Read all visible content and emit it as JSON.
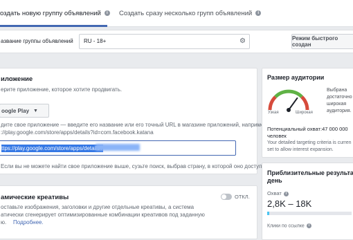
{
  "tabs": [
    {
      "label": "оздать новую группу объявлений"
    },
    {
      "label": "Создать сразу несколько групп объявлений"
    }
  ],
  "adset_name": {
    "label": "азвание группы объявлений",
    "value": "RU - 18+",
    "quick_mode_button": "Режим быстрого создан"
  },
  "app_section": {
    "title": "иложение",
    "subtitle": "ерите приложение, которое хотите продвигать.",
    "store_select": "oogle Play",
    "help_text_1": "дите свое приложение — введите его название или его точный URL в магазине приложений, например",
    "help_text_2": "://play.google.com/store/apps/details?id=com.facebook.katana",
    "url_value": "ttps://play.google.com/store/apps/details?",
    "not_found_text": "Если вы не можете найти свое приложение выше, сузьте поиск, выбрав страну, в которой оно доступно."
  },
  "dynamic_creatives": {
    "title": "амические креативы",
    "toggle_label": "ОТКЛ.",
    "desc_1": "оставьте изображения, заголовки и другие отдельные креативы, а система",
    "desc_2": "атически сгенерирует оптимизированные комбинации креативов под заданную",
    "desc_3": "ю.",
    "learn_more": "Подробнее."
  },
  "audience": {
    "title": "Размер аудитории",
    "gauge_low": "Узкая",
    "gauge_high": "Широкая",
    "gauge_level": 0.7,
    "verdict_1": "Выбрана",
    "verdict_2": "достаточно",
    "verdict_3": "широкая",
    "verdict_4": "аудитория.",
    "potential_reach_1": "Потенциальный охват:47 000 000",
    "potential_reach_2": "человек",
    "note_1": "Your detailed targeting criteria is curren",
    "note_2": "set to allow interest expansion."
  },
  "estimates": {
    "title_1": "Приблизительные результаты",
    "title_2": "день",
    "reach_label": "Охват",
    "reach_value": "2,8K – 18K",
    "reach_fill": 0.02,
    "clicks_label": "Клики по ссылке"
  },
  "colors": {
    "accent": "#4267b2",
    "gauge_red": "#d64b3c",
    "gauge_yellow": "#f0c330",
    "gauge_green": "#5fb245",
    "bar_fill": "#4cc5f2",
    "url_highlight": "#3578e5"
  },
  "icons": {
    "info": "info-icon",
    "settings": "gear-icon",
    "dropdown": "caret-down-icon"
  }
}
